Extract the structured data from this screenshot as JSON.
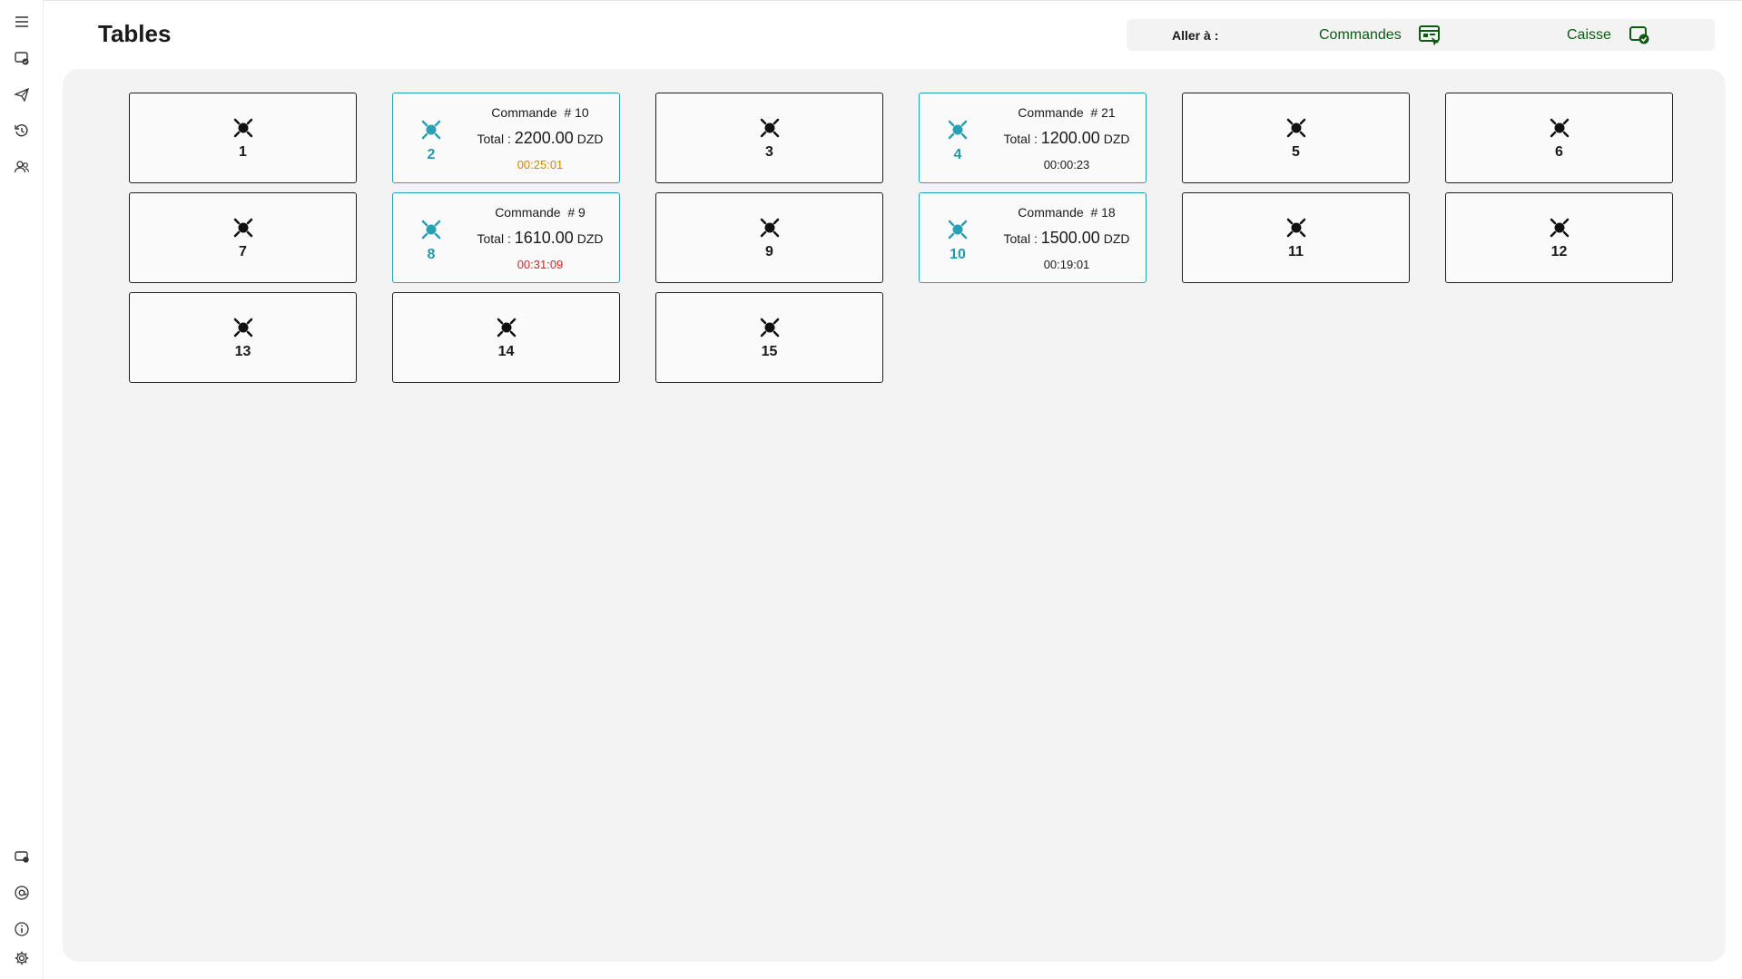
{
  "page": {
    "title": "Tables"
  },
  "goto": {
    "label": "Aller à :",
    "commandes_label": "Commandes",
    "caisse_label": "Caisse",
    "link_color": "#0e5a12"
  },
  "colors": {
    "busy_border": "#2aa0b5",
    "time_warning": "#d08a00",
    "time_late": "#e02020",
    "time_normal": "#1a1a1a"
  },
  "sidebar": {
    "top": [
      "menu-icon",
      "tables-icon",
      "send-icon",
      "history-icon",
      "users-icon"
    ],
    "bottom": [
      "device-icon",
      "at-icon",
      "info-icon",
      "settings-icon"
    ]
  },
  "tables": [
    {
      "num": "1",
      "status": "free"
    },
    {
      "num": "2",
      "status": "busy",
      "order_label": "Commande",
      "order_no": "# 10",
      "total_label": "Total :",
      "amount": "2200.00",
      "currency": "DZD",
      "time": "00:25:01",
      "time_state": "warning"
    },
    {
      "num": "3",
      "status": "free"
    },
    {
      "num": "4",
      "status": "busy",
      "order_label": "Commande",
      "order_no": "# 21",
      "total_label": "Total :",
      "amount": "1200.00",
      "currency": "DZD",
      "time": "00:00:23",
      "time_state": "normal"
    },
    {
      "num": "5",
      "status": "free"
    },
    {
      "num": "6",
      "status": "free"
    },
    {
      "num": "7",
      "status": "free"
    },
    {
      "num": "8",
      "status": "busy",
      "order_label": "Commande",
      "order_no": "# 9",
      "total_label": "Total :",
      "amount": "1610.00",
      "currency": "DZD",
      "time": "00:31:09",
      "time_state": "late"
    },
    {
      "num": "9",
      "status": "free"
    },
    {
      "num": "10",
      "status": "busy",
      "order_label": "Commande",
      "order_no": "# 18",
      "total_label": "Total :",
      "amount": "1500.00",
      "currency": "DZD",
      "time": "00:19:01",
      "time_state": "normal"
    },
    {
      "num": "11",
      "status": "free"
    },
    {
      "num": "12",
      "status": "free"
    },
    {
      "num": "13",
      "status": "free"
    },
    {
      "num": "14",
      "status": "free"
    },
    {
      "num": "15",
      "status": "free"
    }
  ]
}
